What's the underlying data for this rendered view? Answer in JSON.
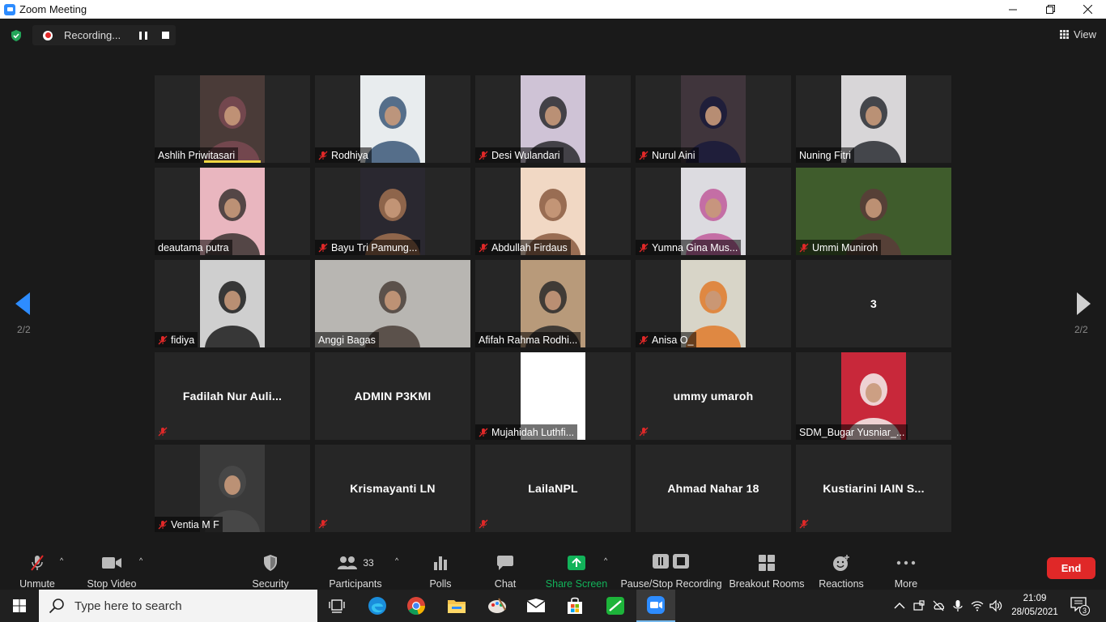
{
  "window": {
    "title": "Zoom Meeting"
  },
  "top_bar": {
    "recording_label": "Recording...",
    "view_label": "View"
  },
  "pagination": {
    "left_indicator": "2/2",
    "right_indicator": "2/2"
  },
  "participants": [
    {
      "name": "Ashlih Priwitasari",
      "muted": false,
      "video": true,
      "speaking": true,
      "bg": "#4a3b38",
      "fg": "#7a4a52"
    },
    {
      "name": "Rodhiya",
      "muted": true,
      "video": true,
      "bg": "#e8ecee",
      "fg": "#3b5878"
    },
    {
      "name": "Desi Wulandari",
      "muted": true,
      "video": true,
      "bg": "#cfc3d6",
      "fg": "#2a2a2e"
    },
    {
      "name": "Nurul Aini",
      "muted": true,
      "video": true,
      "bg": "#40353c",
      "fg": "#1a1a3a"
    },
    {
      "name": "Nuning Fitri",
      "muted": false,
      "video": true,
      "bg": "#d8d6d8",
      "fg": "#2a2d33"
    },
    {
      "name": "deautama putra",
      "muted": false,
      "video": true,
      "bg": "#e9b6bf",
      "fg": "#3a3330"
    },
    {
      "name": "Bayu Tri Pamung...",
      "muted": true,
      "video": true,
      "bg": "#2a2830",
      "fg": "#a07050"
    },
    {
      "name": "Abdullah Firdaus",
      "muted": true,
      "video": true,
      "bg": "#f1d8c4",
      "fg": "#8a5a40"
    },
    {
      "name": "Yumna Gina Mus...",
      "muted": true,
      "video": true,
      "bg": "#dcdbe0",
      "fg": "#c05a9a"
    },
    {
      "name": "Ummi Muniroh",
      "muted": true,
      "video": true,
      "wide": true,
      "bg": "#3f5c2c",
      "fg": "#5b3b3a"
    },
    {
      "name": "fidiya",
      "muted": true,
      "video": true,
      "bg": "#cfcfcf",
      "fg": "#1c1c1c"
    },
    {
      "name": "Anggi Bagas",
      "muted": false,
      "video": true,
      "wide": true,
      "bg": "#b8b6b2",
      "fg": "#4a4038"
    },
    {
      "name": "Afifah Rahma Rodhi...",
      "muted": false,
      "video": true,
      "bg": "#b89a7a",
      "fg": "#2a2a2a"
    },
    {
      "name": "Anisa O_",
      "muted": true,
      "video": true,
      "bg": "#d8d5c8",
      "fg": "#e07a2a"
    },
    {
      "name": "3",
      "muted": false,
      "video": false,
      "no_icon": true
    },
    {
      "name": "Fadilah Nur Auli...",
      "muted": true,
      "video": false
    },
    {
      "name": "ADMIN P3KMI",
      "muted": false,
      "video": false,
      "no_icon": true
    },
    {
      "name": "Mujahidah Luthfi...",
      "muted": true,
      "video": true,
      "bg": "#ffffff",
      "fg": "#ffffff"
    },
    {
      "name": "ummy umaroh",
      "muted": true,
      "video": false
    },
    {
      "name": "SDM_Bugar Yusniar_...",
      "muted": false,
      "video": true,
      "bg": "#c8283a",
      "fg": "#f4f0ee"
    },
    {
      "name": "Ventia M F",
      "muted": true,
      "video": true,
      "bg": "#3a3a3a",
      "fg": "#4a4a4a"
    },
    {
      "name": "Krismayanti LN",
      "muted": true,
      "video": false
    },
    {
      "name": "LailaNPL",
      "muted": true,
      "video": false
    },
    {
      "name": "Ahmad Nahar 18",
      "muted": false,
      "video": false,
      "no_icon": true
    },
    {
      "name": "Kustiarini IAIN S...",
      "muted": true,
      "video": false
    }
  ],
  "toolbar": {
    "unmute": "Unmute",
    "stop_video": "Stop Video",
    "security": "Security",
    "participants": "Participants",
    "participants_count": "33",
    "polls": "Polls",
    "chat": "Chat",
    "share_screen": "Share Screen",
    "recording": "Pause/Stop Recording",
    "breakout": "Breakout Rooms",
    "reactions": "Reactions",
    "more": "More",
    "end": "End"
  },
  "taskbar": {
    "search_placeholder": "Type here to search",
    "time": "21:09",
    "date": "28/05/2021",
    "notification_count": "3"
  },
  "colors": {
    "accent_blue": "#2d8cff",
    "share_green": "#12b35a",
    "end_red": "#e02828",
    "speak_yellow": "#f0d742"
  }
}
